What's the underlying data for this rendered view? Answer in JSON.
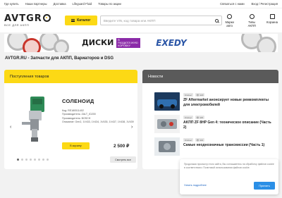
{
  "topbar": {
    "links": [
      "Где купить",
      "Наши партнеры",
      "Доставка",
      "Lifeguard Fluid",
      "Товары по акции"
    ],
    "account": "Связаться с нами",
    "login": "Вход / Регистрация"
  },
  "header": {
    "logo_text": "AVTGR",
    "logo_sub": "ВСЕ ДЛЯ АКПП",
    "catalog": "Каталог",
    "search_placeholder": "Введите VIN, код товара или АКПП",
    "icons": [
      {
        "label": "Марки авто",
        "icon": "car-icon"
      },
      {
        "label": "Типы АКПП",
        "icon": "gearbox-icon"
      },
      {
        "label": "Корзина",
        "icon": "cart-icon"
      }
    ]
  },
  "banner": {
    "headline": "ДИСКИ",
    "tag": "В РАЗДАТОЧНУЮ КОРОБКУ",
    "brand": "EXEDY"
  },
  "page_title": "AVTGR.RU - Запчасти для АКПП, Вариаторов и DSG",
  "products": {
    "header": "Поступления товаров",
    "name": "СОЛЕНОИД",
    "specs": [
      "Код: RE180511402",
      "Производитель: ZALT_ID200",
      "Производитель: BOSCH",
      "Описание: Gen2, 1V433, 1V434, 1V435, 1V437, 1V438, 1V439"
    ],
    "cart_button": "В корзину",
    "price": "2 500 ₽",
    "all_button": "Смотреть все",
    "prev": "‹",
    "next": "›"
  },
  "news": {
    "header": "Новости",
    "items": [
      {
        "date": "Статьи",
        "views": "👁 123",
        "title": "ZF Aftermarket анонсирует новые ремкомплекты для электромобилей"
      },
      {
        "date": "Статьи",
        "views": "👁 115",
        "title": "AKПП ZF 8HP Gen 4: техническое описание (Часть 2)"
      },
      {
        "date": "Статьи",
        "views": "👁 113",
        "title": "Самые неоднозначные трансмиссии (Часть 1)"
      }
    ]
  },
  "cookie": {
    "text": "Продолжая просмотр этого сайта, Вы соглашаетесь на обработку файлов cookie в соответствии с Политикой использования файлов cookie.",
    "more": "Узнать подробнее",
    "accept": "Принять"
  },
  "colors": {
    "accent_yellow": "#fcd915",
    "news_header": "#5a5a5a",
    "link_blue": "#1f66c2",
    "accept_blue": "#2b8fe6"
  }
}
